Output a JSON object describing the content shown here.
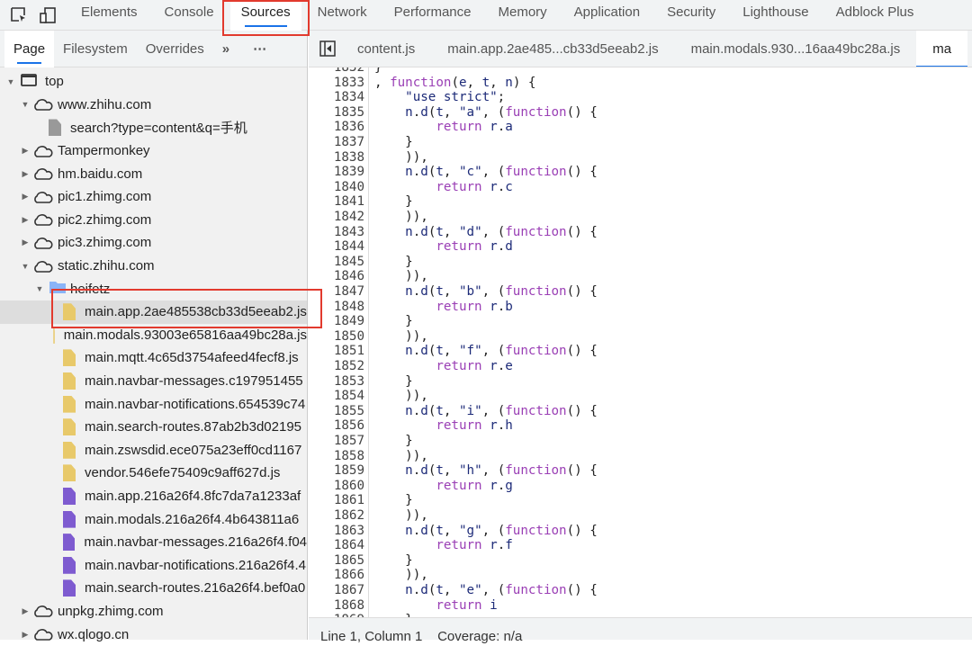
{
  "toolbar": {
    "tabs": [
      "Elements",
      "Console",
      "Sources",
      "Network",
      "Performance",
      "Memory",
      "Application",
      "Security",
      "Lighthouse",
      "Adblock Plus"
    ],
    "active_tab": "Sources"
  },
  "navigator": {
    "tabs": [
      "Page",
      "Filesystem",
      "Overrides"
    ],
    "more": "»",
    "menu": "⋯",
    "tree": [
      {
        "label": "top",
        "depth": 0,
        "type": "frame",
        "expanded": true
      },
      {
        "label": "www.zhihu.com",
        "depth": 1,
        "type": "domain",
        "expanded": true
      },
      {
        "label": "search?type=content&q=手机",
        "depth": 2,
        "type": "doc"
      },
      {
        "label": "Tampermonkey",
        "depth": 1,
        "type": "domain",
        "expanded": false
      },
      {
        "label": "hm.baidu.com",
        "depth": 1,
        "type": "domain",
        "expanded": false
      },
      {
        "label": "pic1.zhimg.com",
        "depth": 1,
        "type": "domain",
        "expanded": false
      },
      {
        "label": "pic2.zhimg.com",
        "depth": 1,
        "type": "domain",
        "expanded": false
      },
      {
        "label": "pic3.zhimg.com",
        "depth": 1,
        "type": "domain",
        "expanded": false
      },
      {
        "label": "static.zhihu.com",
        "depth": 1,
        "type": "domain",
        "expanded": true
      },
      {
        "label": "heifetz",
        "depth": 2,
        "type": "folder",
        "expanded": true
      },
      {
        "label": "main.app.2ae485538cb33d5eeab2.js",
        "depth": 3,
        "type": "js",
        "selected": true
      },
      {
        "label": "main.modals.93003e65816aa49bc28a.js",
        "depth": 3,
        "type": "js"
      },
      {
        "label": "main.mqtt.4c65d3754afeed4fecf8.js",
        "depth": 3,
        "type": "js"
      },
      {
        "label": "main.navbar-messages.c197951455",
        "depth": 3,
        "type": "js"
      },
      {
        "label": "main.navbar-notifications.654539c74",
        "depth": 3,
        "type": "js"
      },
      {
        "label": "main.search-routes.87ab2b3d02195",
        "depth": 3,
        "type": "js"
      },
      {
        "label": "main.zswsdid.ece075a23eff0cd1167",
        "depth": 3,
        "type": "js"
      },
      {
        "label": "vendor.546efe75409c9aff627d.js",
        "depth": 3,
        "type": "js"
      },
      {
        "label": "main.app.216a26f4.8fc7da7a1233af",
        "depth": 3,
        "type": "css"
      },
      {
        "label": "main.modals.216a26f4.4b643811a6",
        "depth": 3,
        "type": "css"
      },
      {
        "label": "main.navbar-messages.216a26f4.f04",
        "depth": 3,
        "type": "css"
      },
      {
        "label": "main.navbar-notifications.216a26f4.4",
        "depth": 3,
        "type": "css"
      },
      {
        "label": "main.search-routes.216a26f4.bef0a0",
        "depth": 3,
        "type": "css"
      },
      {
        "label": "unpkg.zhimg.com",
        "depth": 1,
        "type": "domain",
        "expanded": false
      },
      {
        "label": "wx.qlogo.cn",
        "depth": 1,
        "type": "domain",
        "expanded": false
      }
    ]
  },
  "editor": {
    "tabs": [
      "content.js",
      "main.app.2ae485...cb33d5eeab2.js",
      "main.modals.930...16aa49bc28a.js",
      "ma"
    ],
    "first_line": 1832,
    "lines": [
      "}",
      ", function(e, t, n) {",
      "    \"use strict\";",
      "    n.d(t, \"a\", (function() {",
      "        return r.a",
      "    }",
      "    )),",
      "    n.d(t, \"c\", (function() {",
      "        return r.c",
      "    }",
      "    )),",
      "    n.d(t, \"d\", (function() {",
      "        return r.d",
      "    }",
      "    )),",
      "    n.d(t, \"b\", (function() {",
      "        return r.b",
      "    }",
      "    )),",
      "    n.d(t, \"f\", (function() {",
      "        return r.e",
      "    }",
      "    )),",
      "    n.d(t, \"i\", (function() {",
      "        return r.h",
      "    }",
      "    )),",
      "    n.d(t, \"h\", (function() {",
      "        return r.g",
      "    }",
      "    )),",
      "    n.d(t, \"g\", (function() {",
      "        return r.f",
      "    }",
      "    )),",
      "    n.d(t, \"e\", (function() {",
      "        return i",
      "    }"
    ]
  },
  "status": {
    "position": "Line 1, Column 1",
    "coverage": "Coverage: n/a"
  },
  "colors": {
    "accent": "#1a73e8",
    "highlight": "#e23a2e",
    "keyword": "#9a3fb5",
    "variable": "#1c2a78",
    "js_file": "#e8c96a",
    "css_file": "#7e5bd0"
  }
}
